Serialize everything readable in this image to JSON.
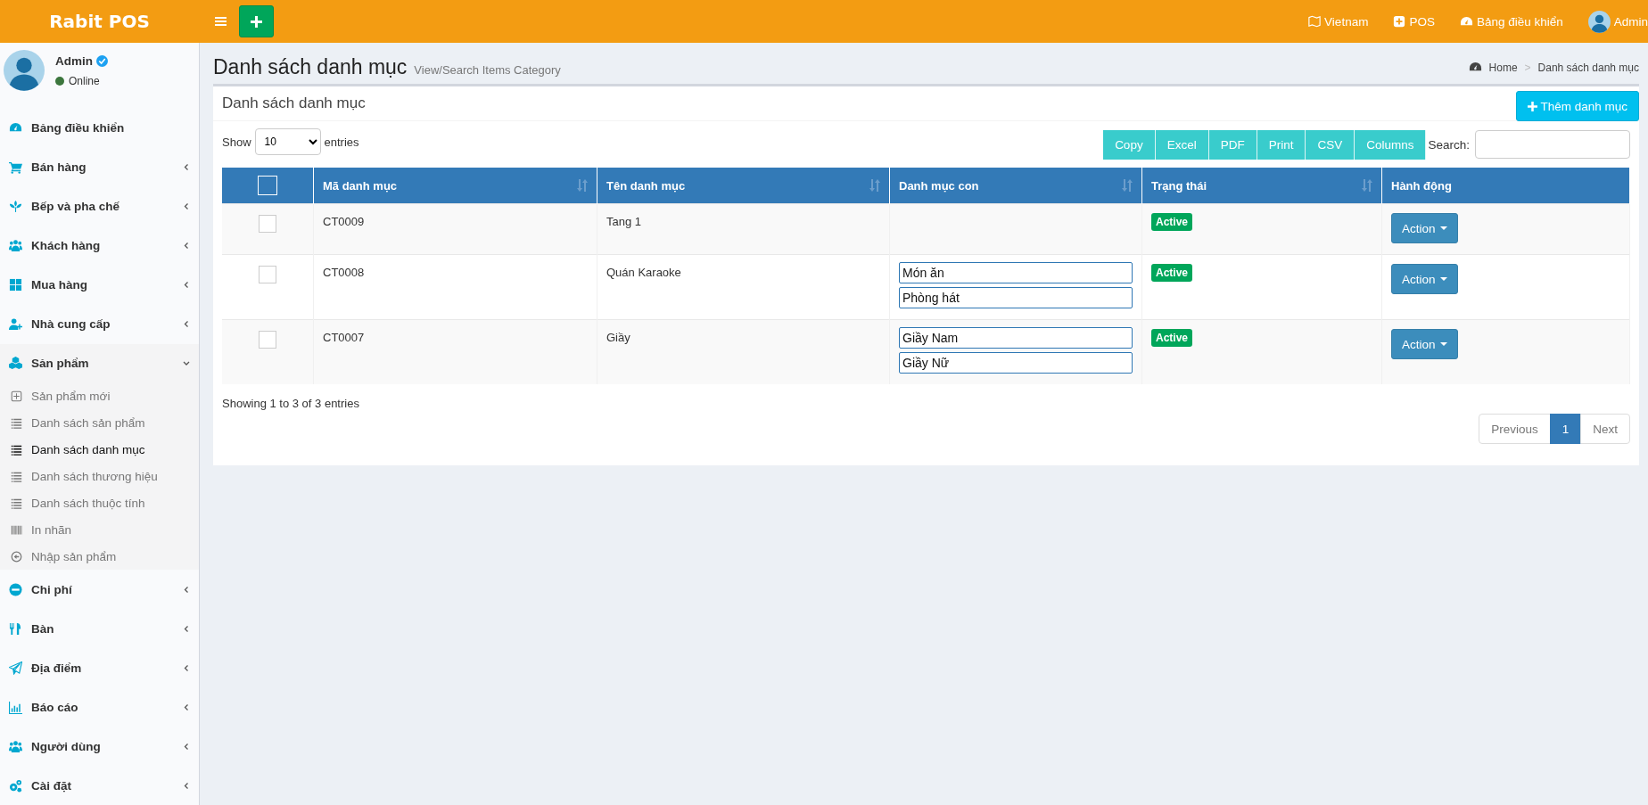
{
  "header": {
    "logo": "Rabit POS",
    "nav": [
      {
        "label": "Vietnam"
      },
      {
        "label": "POS"
      },
      {
        "label": "Bảng điều khiển"
      },
      {
        "label": "Admin"
      }
    ]
  },
  "user": {
    "name": "Admin",
    "status": "Online"
  },
  "sidebar": {
    "items": [
      {
        "label": "Bảng điều khiển",
        "has_chevron": false,
        "expanded": false
      },
      {
        "label": "Bán hàng",
        "has_chevron": true,
        "expanded": false
      },
      {
        "label": "Bếp và pha chế",
        "has_chevron": true,
        "expanded": false
      },
      {
        "label": "Khách hàng",
        "has_chevron": true,
        "expanded": false
      },
      {
        "label": "Mua hàng",
        "has_chevron": true,
        "expanded": false
      },
      {
        "label": "Nhà cung cấp",
        "has_chevron": true,
        "expanded": false
      },
      {
        "label": "Sản phẩm",
        "has_chevron": true,
        "expanded": true,
        "children": [
          {
            "label": "Sản phẩm mới",
            "selected": false
          },
          {
            "label": "Danh sách sản phẩm",
            "selected": false
          },
          {
            "label": "Danh sách danh mục",
            "selected": true
          },
          {
            "label": "Danh sách thương hiệu",
            "selected": false
          },
          {
            "label": "Danh sách thuộc tính",
            "selected": false
          },
          {
            "label": "In nhãn",
            "selected": false
          },
          {
            "label": "Nhập sản phẩm",
            "selected": false
          }
        ]
      },
      {
        "label": "Chi phí",
        "has_chevron": true,
        "expanded": false
      },
      {
        "label": "Bàn",
        "has_chevron": true,
        "expanded": false
      },
      {
        "label": "Địa điểm",
        "has_chevron": true,
        "expanded": false
      },
      {
        "label": "Báo cáo",
        "has_chevron": true,
        "expanded": false
      },
      {
        "label": "Người dùng",
        "has_chevron": true,
        "expanded": false
      },
      {
        "label": "Cài đặt",
        "has_chevron": true,
        "expanded": false
      }
    ]
  },
  "page": {
    "title": "Danh sách danh mục",
    "subtitle": "View/Search Items Category",
    "breadcrumb": [
      "Home",
      "Danh sách danh mục"
    ],
    "breadcrumb_separator": ">"
  },
  "box": {
    "title": "Danh sách danh mục",
    "add_button": "Thêm danh mục",
    "length": {
      "before": "Show",
      "value": "10",
      "after": "entries"
    },
    "export_buttons": [
      "Copy",
      "Excel",
      "PDF",
      "Print",
      "CSV",
      "Columns"
    ],
    "search": {
      "label": "Search:"
    },
    "table": {
      "header_checkbox": {
        "checked": false
      },
      "columns": [
        {
          "label": "Mã danh mục",
          "sortable": true
        },
        {
          "label": "Tên danh mục",
          "sortable": true
        },
        {
          "label": "Danh mục con",
          "sortable": true
        },
        {
          "label": "Trạng thái",
          "sortable": true
        },
        {
          "label": "Hành động",
          "sortable": false
        }
      ],
      "rows": [
        {
          "checked": false,
          "code": "CT0009",
          "name": "Tang 1",
          "children": [],
          "status": "Active",
          "action": "Action"
        },
        {
          "checked": false,
          "code": "CT0008",
          "name": "Quán Karaoke",
          "children": [
            "Món ăn",
            "Phòng hát"
          ],
          "status": "Active",
          "action": "Action"
        },
        {
          "checked": false,
          "code": "CT0007",
          "name": "Giầy",
          "children": [
            "Giầy Nam",
            "Giầy Nữ"
          ],
          "status": "Active",
          "action": "Action"
        }
      ]
    },
    "info": "Showing 1 to 3 of 3 entries",
    "pagination": {
      "previous": "Previous",
      "next": "Next",
      "pages": [
        {
          "label": "1",
          "selected": true
        }
      ]
    }
  }
}
